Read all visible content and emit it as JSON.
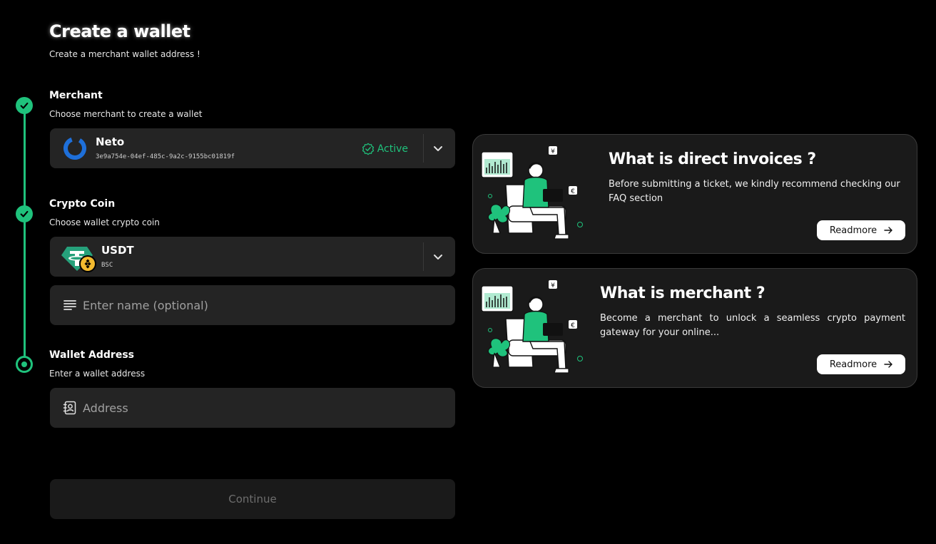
{
  "header": {
    "title": "Create a wallet",
    "subtitle": "Create a merchant wallet address !"
  },
  "steps": {
    "merchant": {
      "label": "Merchant",
      "help": "Choose merchant to create a wallet",
      "selected_name": "Neto",
      "selected_id": "3e9a754e-04ef-485c-9a2c-9155bc01819f",
      "status": "Active"
    },
    "coin": {
      "label": "Crypto Coin",
      "help": "Choose wallet crypto coin",
      "selected_coin": "USDT",
      "selected_network": "BSC",
      "name_placeholder": "Enter name (optional)"
    },
    "wallet": {
      "label": "Wallet Address",
      "help": "Enter a wallet address",
      "address_placeholder": "Address"
    }
  },
  "continue_label": "Continue",
  "info_cards": [
    {
      "title": "What is direct invoices ?",
      "description": "Before submitting a ticket, we kindly recommend checking our FAQ section",
      "button_label": "Readmore"
    },
    {
      "title": "What is merchant ?",
      "description": "Become a merchant to unlock a seamless crypto payment gateway for your online...",
      "button_label": "Readmore"
    }
  ],
  "colors": {
    "accent": "#1fc27c",
    "background": "#000000",
    "field": "#242424",
    "card": "#1a1a1a",
    "tether": "#26a17b",
    "bsc": "#f3ba2f",
    "merchant_logo": "#1e6fd9"
  },
  "icons": {
    "step_done": "check-icon",
    "step_current": "dot-icon",
    "dropdown": "chevron-down-icon",
    "status": "check-circle-icon",
    "name_field": "lines-icon",
    "address_field": "address-book-icon",
    "readmore": "arrow-right-icon"
  }
}
